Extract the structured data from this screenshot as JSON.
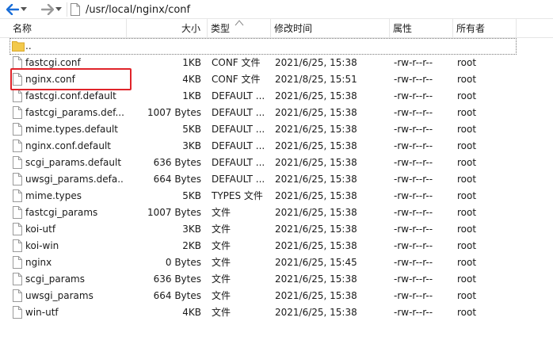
{
  "address": {
    "path": "/usr/local/nginx/conf"
  },
  "columns": {
    "name": "名称",
    "size": "大小",
    "type": "类型",
    "modified": "修改时间",
    "perms": "属性",
    "owner": "所有者"
  },
  "parent_row": {
    "name": ".."
  },
  "files": [
    {
      "name": "fastcgi.conf",
      "size": "1KB",
      "type": "CONF 文件",
      "modified": "2021/6/25, 15:38",
      "perms": "-rw-r--r--",
      "owner": "root"
    },
    {
      "name": "nginx.conf",
      "size": "4KB",
      "type": "CONF 文件",
      "modified": "2021/8/25, 15:51",
      "perms": "-rw-r--r--",
      "owner": "root"
    },
    {
      "name": "fastcgi.conf.default",
      "size": "1KB",
      "type": "DEFAULT ...",
      "modified": "2021/6/25, 15:38",
      "perms": "-rw-r--r--",
      "owner": "root"
    },
    {
      "name": "fastcgi_params.def...",
      "size": "1007 Bytes",
      "type": "DEFAULT ...",
      "modified": "2021/6/25, 15:38",
      "perms": "-rw-r--r--",
      "owner": "root"
    },
    {
      "name": "mime.types.default",
      "size": "5KB",
      "type": "DEFAULT ...",
      "modified": "2021/6/25, 15:38",
      "perms": "-rw-r--r--",
      "owner": "root"
    },
    {
      "name": "nginx.conf.default",
      "size": "3KB",
      "type": "DEFAULT ...",
      "modified": "2021/6/25, 15:38",
      "perms": "-rw-r--r--",
      "owner": "root"
    },
    {
      "name": "scgi_params.default",
      "size": "636 Bytes",
      "type": "DEFAULT ...",
      "modified": "2021/6/25, 15:38",
      "perms": "-rw-r--r--",
      "owner": "root"
    },
    {
      "name": "uwsgi_params.defa...",
      "size": "664 Bytes",
      "type": "DEFAULT ...",
      "modified": "2021/6/25, 15:38",
      "perms": "-rw-r--r--",
      "owner": "root"
    },
    {
      "name": "mime.types",
      "size": "5KB",
      "type": "TYPES 文件",
      "modified": "2021/6/25, 15:38",
      "perms": "-rw-r--r--",
      "owner": "root"
    },
    {
      "name": "fastcgi_params",
      "size": "1007 Bytes",
      "type": "文件",
      "modified": "2021/6/25, 15:38",
      "perms": "-rw-r--r--",
      "owner": "root"
    },
    {
      "name": "koi-utf",
      "size": "3KB",
      "type": "文件",
      "modified": "2021/6/25, 15:38",
      "perms": "-rw-r--r--",
      "owner": "root"
    },
    {
      "name": "koi-win",
      "size": "2KB",
      "type": "文件",
      "modified": "2021/6/25, 15:38",
      "perms": "-rw-r--r--",
      "owner": "root"
    },
    {
      "name": "nginx",
      "size": "0 Bytes",
      "type": "文件",
      "modified": "2021/6/25, 15:45",
      "perms": "-rw-r--r--",
      "owner": "root"
    },
    {
      "name": "scgi_params",
      "size": "636 Bytes",
      "type": "文件",
      "modified": "2021/6/25, 15:38",
      "perms": "-rw-r--r--",
      "owner": "root"
    },
    {
      "name": "uwsgi_params",
      "size": "664 Bytes",
      "type": "文件",
      "modified": "2021/6/25, 15:38",
      "perms": "-rw-r--r--",
      "owner": "root"
    },
    {
      "name": "win-utf",
      "size": "4KB",
      "type": "文件",
      "modified": "2021/6/25, 15:38",
      "perms": "-rw-r--r--",
      "owner": "root"
    }
  ],
  "colors": {
    "highlight": "#e0242a",
    "folder": "#f2c94c"
  }
}
